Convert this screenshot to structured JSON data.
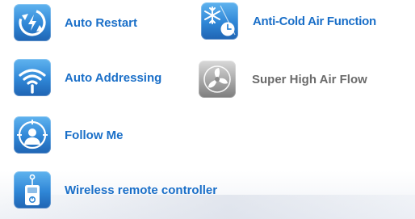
{
  "features": {
    "auto_restart": {
      "label": "Auto Restart",
      "icon": "auto-restart-icon"
    },
    "anti_cold": {
      "label": "Anti-Cold Air Function",
      "icon": "snowflake-clock-icon"
    },
    "auto_addressing": {
      "label": "Auto Addressing",
      "icon": "wifi-icon"
    },
    "super_high_air_flow": {
      "label": "Super High Air Flow",
      "icon": "fan-icon"
    },
    "follow_me": {
      "label": "Follow Me",
      "icon": "person-target-icon"
    },
    "wireless_remote": {
      "label": "Wireless remote controller",
      "icon": "remote-controller-icon"
    }
  },
  "colors": {
    "accent_blue": "#1a6fc8",
    "muted_gray": "#6b6b6b"
  }
}
